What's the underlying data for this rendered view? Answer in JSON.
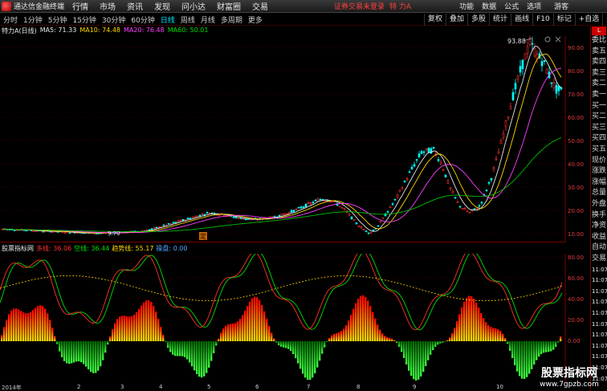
{
  "titlebar": {
    "app_name": "通达信金融终端",
    "menus": [
      "行情",
      "市场",
      "资讯",
      "发现",
      "问小达",
      "财富圈",
      "交易"
    ],
    "login_status": "证券交易未登录",
    "stock_name": "特 力A",
    "right_menus": [
      "功能",
      "数据",
      "公式",
      "选项"
    ],
    "guest": "游客"
  },
  "periods": [
    "分时",
    "1分钟",
    "5分钟",
    "15分钟",
    "30分钟",
    "60分钟",
    "日线",
    "周线",
    "月线",
    "多周期",
    "更多"
  ],
  "active_period": "日线",
  "toolbar": [
    "复权",
    "叠加",
    "多股",
    "统计",
    "画线",
    "F10",
    "标记",
    "+自选",
    "返回"
  ],
  "ma_line": {
    "title": "特力A(日线)",
    "items": [
      {
        "label": "MA5: 71.33",
        "color": "#e8e8e8"
      },
      {
        "label": "MA10: 74.48",
        "color": "#ffd800"
      },
      {
        "label": "MA20: 76.48",
        "color": "#ff40ff"
      },
      {
        "label": "MA60: 50.01",
        "color": "#00e000"
      }
    ]
  },
  "indicator_line": {
    "title": "股票指标网",
    "items": [
      {
        "label": "多线: 36.06",
        "color": "#ff3030"
      },
      {
        "label": "空线: 36.44",
        "color": "#00e000"
      },
      {
        "label": "趋势线: 55.17",
        "color": "#ffd800"
      },
      {
        "label": "操盘: 0.00",
        "color": "#4da6ff"
      }
    ]
  },
  "annotations": {
    "high": "93.88",
    "low": "9.70",
    "ding_marker": "定"
  },
  "price_axis": [
    "90.00",
    "80.00",
    "70.00",
    "60.00",
    "50.00",
    "40.00",
    "30.00",
    "20.00",
    "10.00"
  ],
  "ind_axis": [
    "80.00",
    "60.00",
    "40.00",
    "20.00",
    "0.00"
  ],
  "dates": [
    "2014年",
    "2",
    "3",
    "4",
    "5",
    "6",
    "7",
    "8",
    "9",
    "10"
  ],
  "right_panel": {
    "button": "L",
    "labels": [
      "委比",
      "卖五",
      "卖四",
      "卖三",
      "卖二",
      "卖一",
      "买一",
      "买二",
      "买三",
      "买四",
      "买五",
      "现价",
      "涨跌",
      "涨幅",
      "总量",
      "外盘",
      "换手",
      "净资",
      "收益",
      "自动",
      "交易",
      "11:07",
      "11:07",
      "11:07",
      "11:07",
      "11:07",
      "11:07",
      "11:07",
      "11:07",
      "11:07",
      "11:07",
      "11:07"
    ]
  },
  "watermark": {
    "title": "股票指标网",
    "url": "www.7gpzb.com"
  },
  "colors": {
    "up": "#ff3030",
    "down": "#00ffff",
    "ma60": "#00c000",
    "panel_border": "#7a0000"
  }
}
